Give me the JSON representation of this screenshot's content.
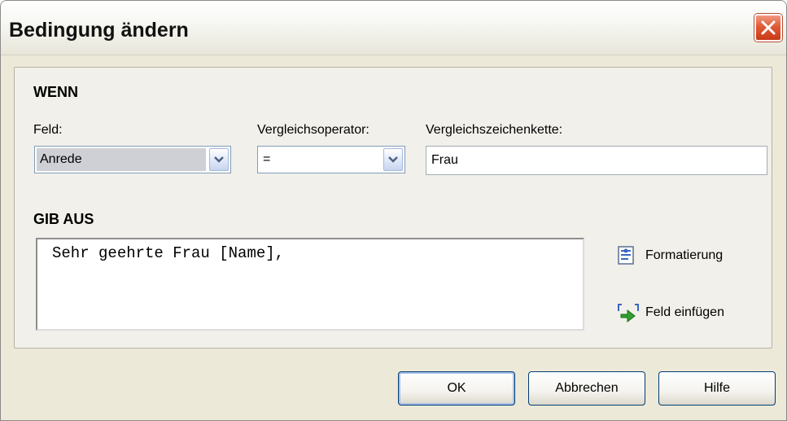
{
  "dialog": {
    "title": "Bedingung ändern"
  },
  "condition": {
    "section_label": "WENN",
    "field": {
      "label": "Feld:",
      "value": "Anrede"
    },
    "operator": {
      "label": "Vergleichsoperator:",
      "value": "="
    },
    "compare": {
      "label": "Vergleichszeichenkette:",
      "value": "Frau"
    }
  },
  "output": {
    "section_label": "GIB AUS",
    "text": "Sehr geehrte Frau [Name],",
    "format_label": "Formatierung",
    "insert_field_label": "Feld einfügen"
  },
  "buttons": {
    "ok": "OK",
    "cancel": "Abbrechen",
    "help": "Hilfe"
  },
  "colors": {
    "close_button": "#e25a35",
    "window_bg": "#ece9d8",
    "input_border": "#7f9db9",
    "button_border": "#003c74"
  },
  "icons": [
    "close-icon",
    "chevron-down-icon",
    "formatting-icon",
    "insert-field-icon"
  ]
}
